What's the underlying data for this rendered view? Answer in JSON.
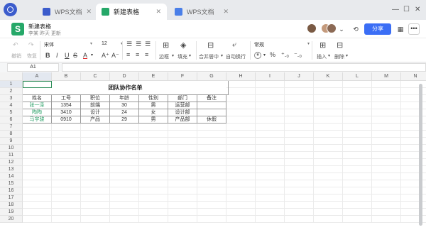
{
  "tabs": [
    {
      "label": "WPS文档",
      "icon": "wps-doc-icon",
      "color": "#3b5ccc"
    },
    {
      "label": "新建表格",
      "icon": "sheet-icon",
      "color": "#26a869"
    },
    {
      "label": "WPS文档",
      "icon": "doc-icon",
      "color": "#4a7fe8"
    }
  ],
  "window": {
    "minimize": "—",
    "maximize": "☐",
    "close": "✕"
  },
  "header": {
    "doc_icon_letter": "S",
    "title": "新建表格",
    "subtitle": "李某 昨天 更新",
    "share_label": "分享",
    "more_label": "•••",
    "history_icon": "history-icon",
    "grid_icon": "qr-icon",
    "brand_color": "#3b6ef5"
  },
  "toolbar": {
    "undo": "撤销",
    "redo": "恢复",
    "font": "宋体",
    "size": "12",
    "bold": "B",
    "italic": "I",
    "underline": "U",
    "strike": "S",
    "font_color": "A",
    "grow": "A⁺",
    "shrink": "A⁻",
    "border": "边框",
    "fill": "填充",
    "merge": "合并居中",
    "wrap": "自动换行",
    "format": "常规",
    "currency": "¥",
    "percent": "%",
    "inc_dec": "⁺.₀",
    "dec_dec": "⁻.₀",
    "insert": "插入",
    "delete": "删除"
  },
  "formula_bar": {
    "cell_ref": "A1",
    "value": ""
  },
  "columns": [
    "A",
    "B",
    "C",
    "D",
    "E",
    "F",
    "G",
    "H",
    "I",
    "J",
    "K",
    "L",
    "M",
    "N"
  ],
  "rows": [
    "1",
    "2",
    "3",
    "4",
    "5",
    "6",
    "7",
    "8",
    "9",
    "10",
    "11",
    "12",
    "13",
    "14",
    "15",
    "16",
    "17",
    "18",
    "19",
    "20"
  ],
  "sheet": {
    "title": "团队协作名单",
    "headers": [
      "姓名",
      "工号",
      "职位",
      "年龄",
      "性别",
      "部门",
      "备注"
    ],
    "data": [
      [
        "张一泽",
        "1354",
        "前端",
        "30",
        "男",
        "运营部",
        ""
      ],
      [
        "陶陶",
        "3410",
        "设计",
        "24",
        "女",
        "设计部",
        ""
      ],
      [
        "马宇骏",
        "0910",
        "产品",
        "29",
        "男",
        "产品部",
        "休假"
      ]
    ]
  }
}
